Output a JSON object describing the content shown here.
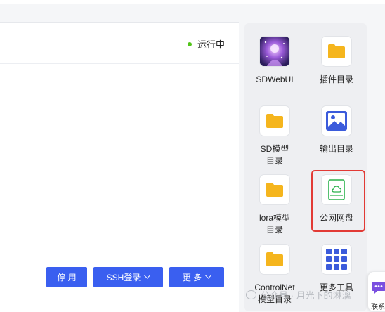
{
  "colors": {
    "accent": "#3a5ff0",
    "folder": "#f5b51d",
    "running": "#52c41a",
    "highlight": "#e23a35",
    "image_icon": "#3b5bdb"
  },
  "instance": {
    "status": "运行中"
  },
  "actions": {
    "stop": "停 用",
    "ssh": "SSH登录",
    "more": "更 多"
  },
  "tools": [
    {
      "label": "SDWebUI",
      "icon": "sdwebui-thumbnail-icon"
    },
    {
      "label": "插件目录",
      "icon": "folder-icon"
    },
    {
      "label": "SD模型",
      "label2": "目录",
      "icon": "folder-icon"
    },
    {
      "label": "输出目录",
      "icon": "image-icon"
    },
    {
      "label": "lora模型",
      "label2": "目录",
      "icon": "folder-icon"
    },
    {
      "label": "公网网盘",
      "icon": "cloud-disk-icon"
    },
    {
      "label": "ControlNet",
      "label2": "模型目录",
      "icon": "folder-icon"
    },
    {
      "label": "更多工具",
      "icon": "grid-icon"
    }
  ],
  "watermark": "公众号 · 月光下的淋漓",
  "contact": {
    "label": "联系"
  }
}
